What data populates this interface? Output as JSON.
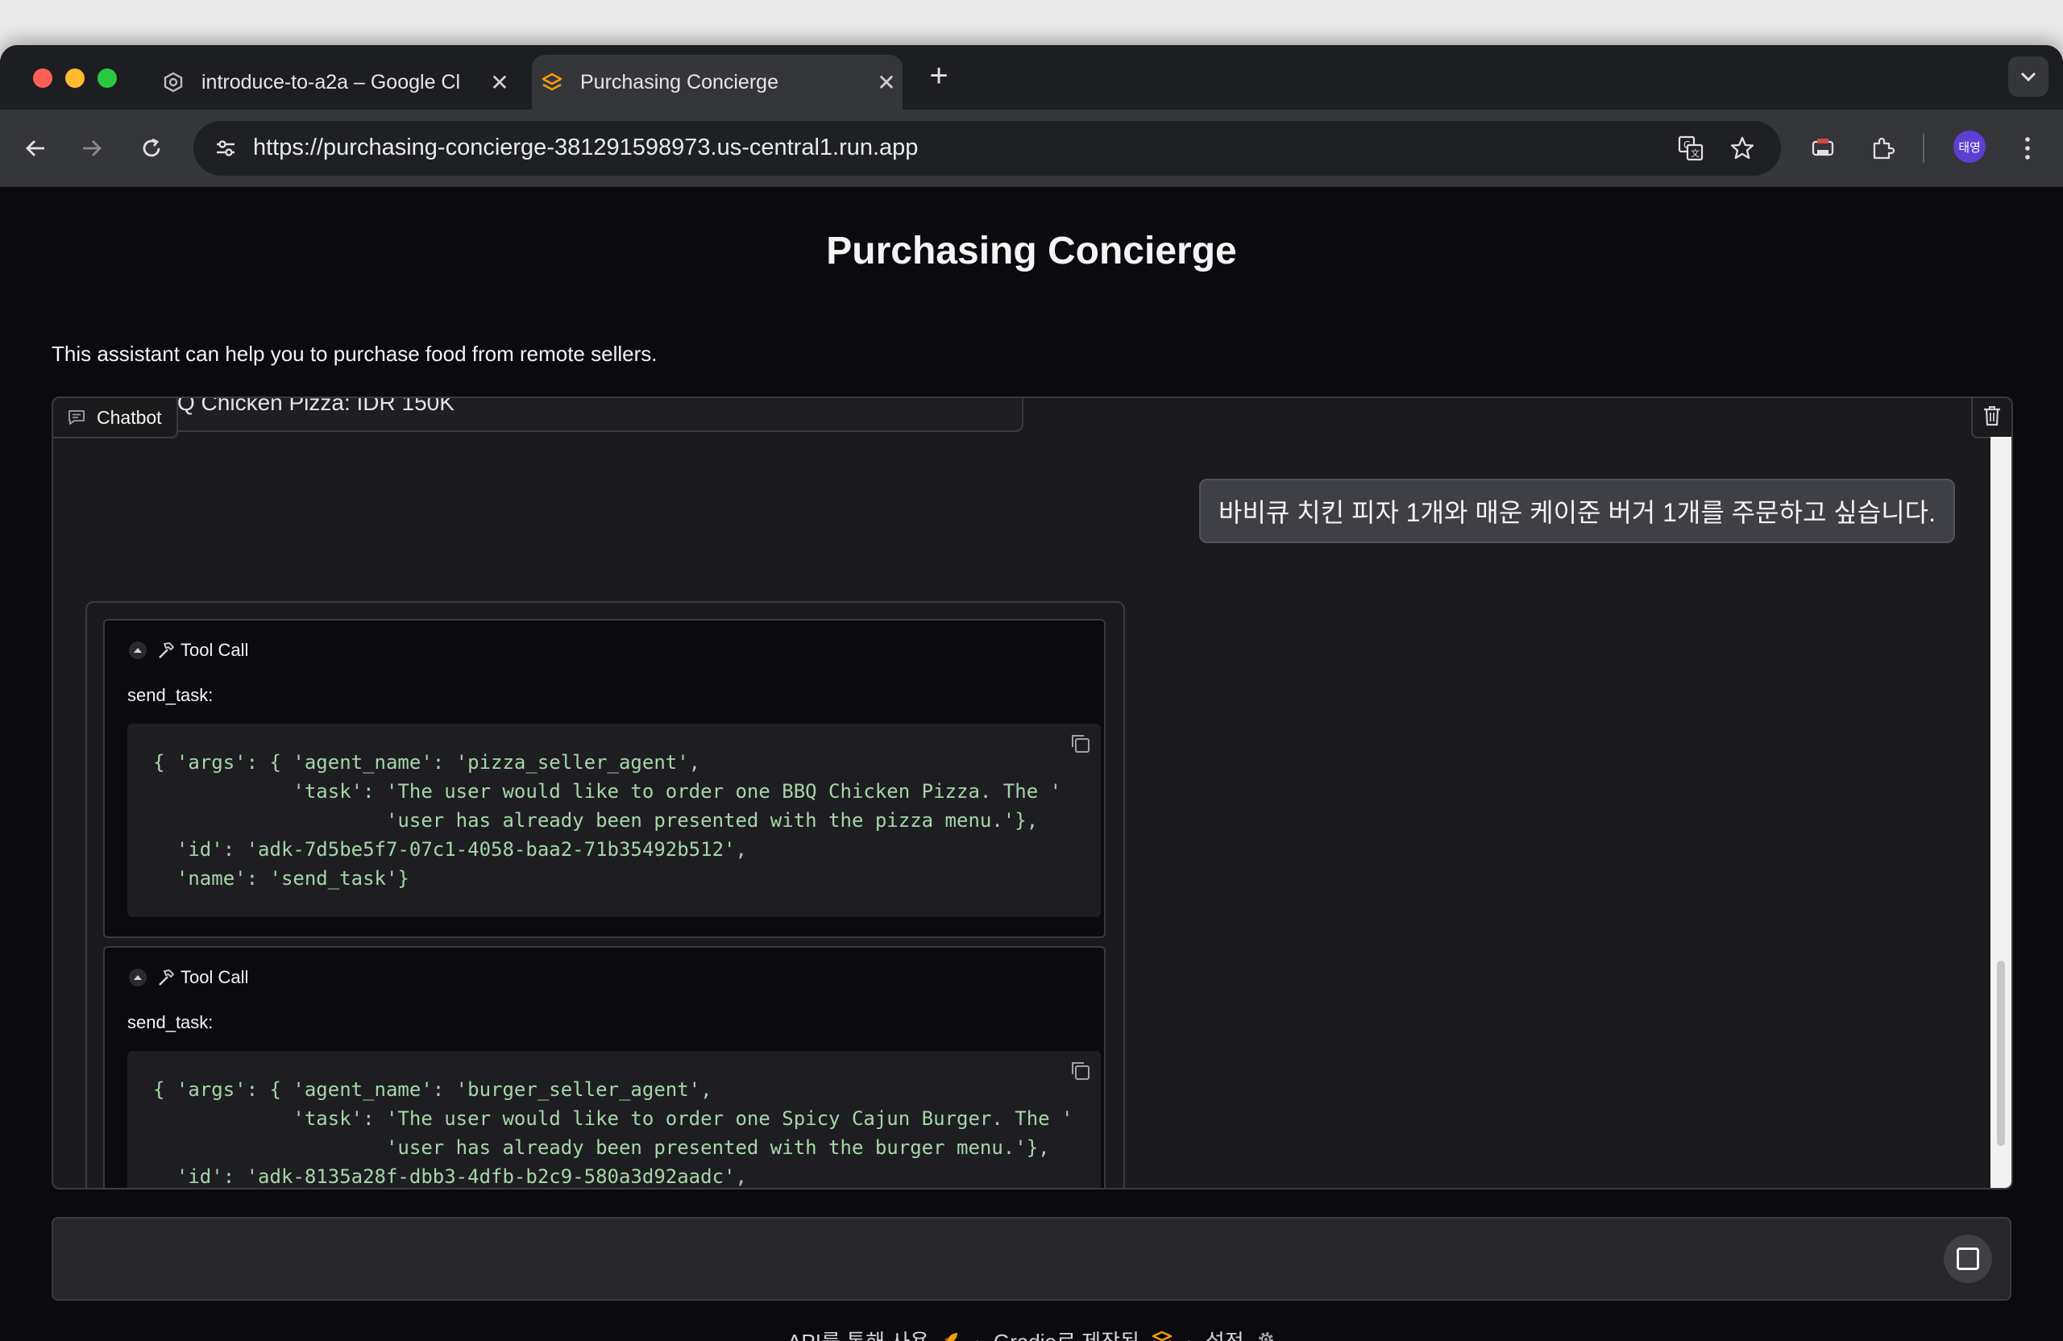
{
  "browser": {
    "tabs": [
      {
        "title": "introduce-to-a2a – Google Cl",
        "active": false,
        "icon": "cloud-shell-icon"
      },
      {
        "title": "Purchasing Concierge",
        "active": true,
        "icon": "gradio-logo-icon"
      }
    ],
    "url": "https://purchasing-concierge-381291598973.us-central1.run.app",
    "profile_initials": "태영"
  },
  "page": {
    "title": "Purchasing Concierge",
    "description": "This assistant can help you to purchase food from remote sellers."
  },
  "chatbot": {
    "label": "Chatbot",
    "previous_message_fragment": "Q Chicken Pizza: IDR 150K",
    "user_message": "바비큐 치킨 피자 1개와 매운 케이준 버거 1개를 주문하고 싶습니다.",
    "tool_calls": [
      {
        "header": "Tool Call",
        "function": "send_task:",
        "code": "{ 'args': { 'agent_name': 'pizza_seller_agent',\n            'task': 'The user would like to order one BBQ Chicken Pizza. The '\n                    'user has already been presented with the pizza menu.'},\n  'id': 'adk-7d5be5f7-07c1-4058-baa2-71b35492b512',\n  'name': 'send_task'}"
      },
      {
        "header": "Tool Call",
        "function": "send_task:",
        "code": "{ 'args': { 'agent_name': 'burger_seller_agent',\n            'task': 'The user would like to order one Spicy Cajun Burger. The '\n                    'user has already been presented with the burger menu.'},\n  'id': 'adk-8135a28f-dbb3-4dfb-b2c9-580a3d92aadc',"
      }
    ]
  },
  "footer": {
    "api_text": "API를 통해 사용",
    "built_text": "Gradio로 제작됨",
    "settings_text": "설정",
    "separator": "·"
  },
  "colors": {
    "accent": "#f59e0b",
    "page_bg": "#0b0b0f",
    "panel_bg": "#1b1b1e",
    "code_text": "#a5d6a7"
  }
}
